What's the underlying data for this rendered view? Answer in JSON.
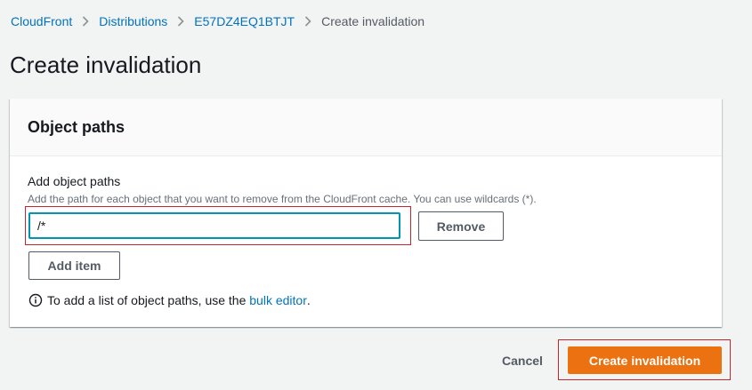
{
  "breadcrumb": {
    "items": [
      {
        "label": "CloudFront"
      },
      {
        "label": "Distributions"
      },
      {
        "label": "E57DZ4EQ1BTJT"
      }
    ],
    "current": "Create invalidation"
  },
  "page": {
    "title": "Create invalidation"
  },
  "panel": {
    "title": "Object paths",
    "field_label": "Add object paths",
    "field_description": "Add the path for each object that you want to remove from the CloudFront cache. You can use wildcards (*).",
    "path_value": "/*",
    "remove_label": "Remove",
    "add_item_label": "Add item",
    "info_text": "To add a list of object paths, use the",
    "info_link": "bulk editor",
    "info_suffix": "."
  },
  "actions": {
    "cancel_label": "Cancel",
    "submit_label": "Create invalidation"
  },
  "colors": {
    "link": "#0073bb",
    "primary": "#ec7211",
    "input_focus": "#0095b3",
    "highlight": "#c7252b",
    "background": "#f2f3f3"
  },
  "icons": {
    "separator": "chevron-right-icon",
    "info": "info-icon"
  }
}
